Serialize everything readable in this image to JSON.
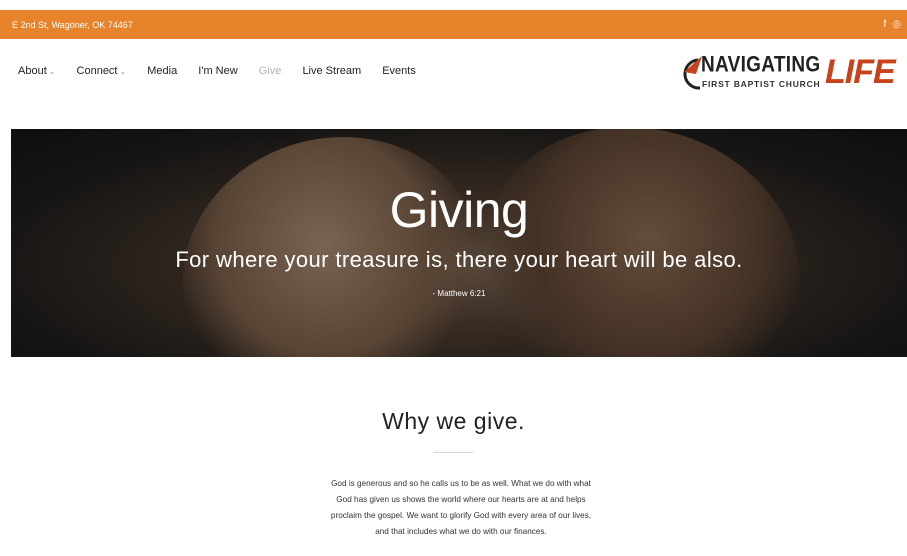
{
  "topbar": {
    "address": "E 2nd St, Wagoner, OK 74467",
    "social": [
      {
        "icon": "facebook-icon",
        "glyph": "f"
      },
      {
        "icon": "instagram-icon",
        "glyph": "◎"
      }
    ],
    "background_color": "#e7832b"
  },
  "nav": {
    "items": [
      {
        "label": "About",
        "caret": "⌄"
      },
      {
        "label": "Connect",
        "caret": "⌄"
      },
      {
        "label": "Media"
      },
      {
        "label": "I'm New"
      },
      {
        "label": "Give",
        "active": true
      },
      {
        "label": "Live Stream"
      },
      {
        "label": "Events"
      }
    ]
  },
  "logo": {
    "line1": "NAVIGATING",
    "line2": "FIRST BAPTIST CHURCH",
    "line3": "LIFE",
    "accent_color": "#c8431c"
  },
  "hero": {
    "title": "Giving",
    "verse": "For where your treasure is, there your heart will be also.",
    "reference": "- Matthew 6:21"
  },
  "why": {
    "title": "Why we give.",
    "body": "God is generous and so he calls us to be as well.  What we do with what God has given us shows the world where our hearts are at and helps proclaim the gospel. We want to glorify God with every area of our lives, and that includes what we do with our finances."
  }
}
